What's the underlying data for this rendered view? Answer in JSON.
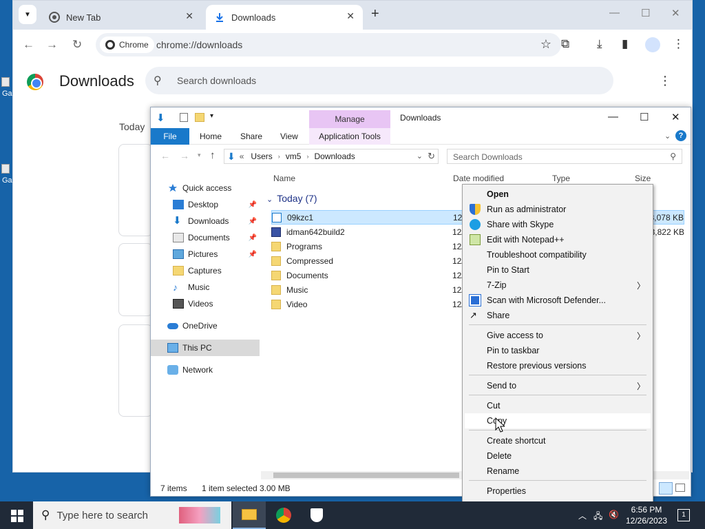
{
  "desktop": {
    "icon_label_1": "Ga",
    "icon_label_2": "Ga"
  },
  "chrome": {
    "tabs": [
      {
        "label": "New Tab"
      },
      {
        "label": "Downloads"
      }
    ],
    "address": {
      "chip": "Chrome",
      "url": "chrome://downloads"
    },
    "page": {
      "title": "Downloads",
      "search_placeholder": "Search downloads",
      "today_label": "Today"
    }
  },
  "explorer": {
    "title": "Downloads",
    "manage_label": "Manage",
    "ribbon": {
      "file": "File",
      "home": "Home",
      "share": "Share",
      "view": "View",
      "app_tools": "Application Tools"
    },
    "breadcrumb": {
      "prefix": "«",
      "parts": [
        "Users",
        "vm5",
        "Downloads"
      ]
    },
    "search_placeholder": "Search Downloads",
    "nav": {
      "quick_access": "Quick access",
      "items": [
        "Desktop",
        "Downloads",
        "Documents",
        "Pictures",
        "Captures",
        "Music",
        "Videos"
      ],
      "onedrive": "OneDrive",
      "this_pc": "This PC",
      "network": "Network"
    },
    "columns": {
      "name": "Name",
      "date": "Date modified",
      "type": "Type",
      "size": "Size"
    },
    "group_label": "Today (7)",
    "files": [
      {
        "name": "09kzc1",
        "date": "12/",
        "size": "3,078 KB"
      },
      {
        "name": "idman642build2",
        "date": "12/",
        "size": "3,822 KB"
      },
      {
        "name": "Programs",
        "date": "12/",
        "size": ""
      },
      {
        "name": "Compressed",
        "date": "12/",
        "size": ""
      },
      {
        "name": "Documents",
        "date": "12/",
        "size": ""
      },
      {
        "name": "Music",
        "date": "12/",
        "size": ""
      },
      {
        "name": "Video",
        "date": "12/",
        "size": ""
      }
    ],
    "status": {
      "count": "7 items",
      "selected": "1 item selected",
      "size": "3.00 MB"
    }
  },
  "context_menu": {
    "items": [
      "Open",
      "Run as administrator",
      "Share with Skype",
      "Edit with Notepad++",
      "Troubleshoot compatibility",
      "Pin to Start",
      "7-Zip",
      "Scan with Microsoft Defender...",
      "Share",
      "Give access to",
      "Pin to taskbar",
      "Restore previous versions",
      "Send to",
      "Cut",
      "Copy",
      "Create shortcut",
      "Delete",
      "Rename",
      "Properties"
    ]
  },
  "taskbar": {
    "search_placeholder": "Type here to search",
    "time": "6:56 PM",
    "date": "12/26/2023",
    "notifications": "1"
  }
}
